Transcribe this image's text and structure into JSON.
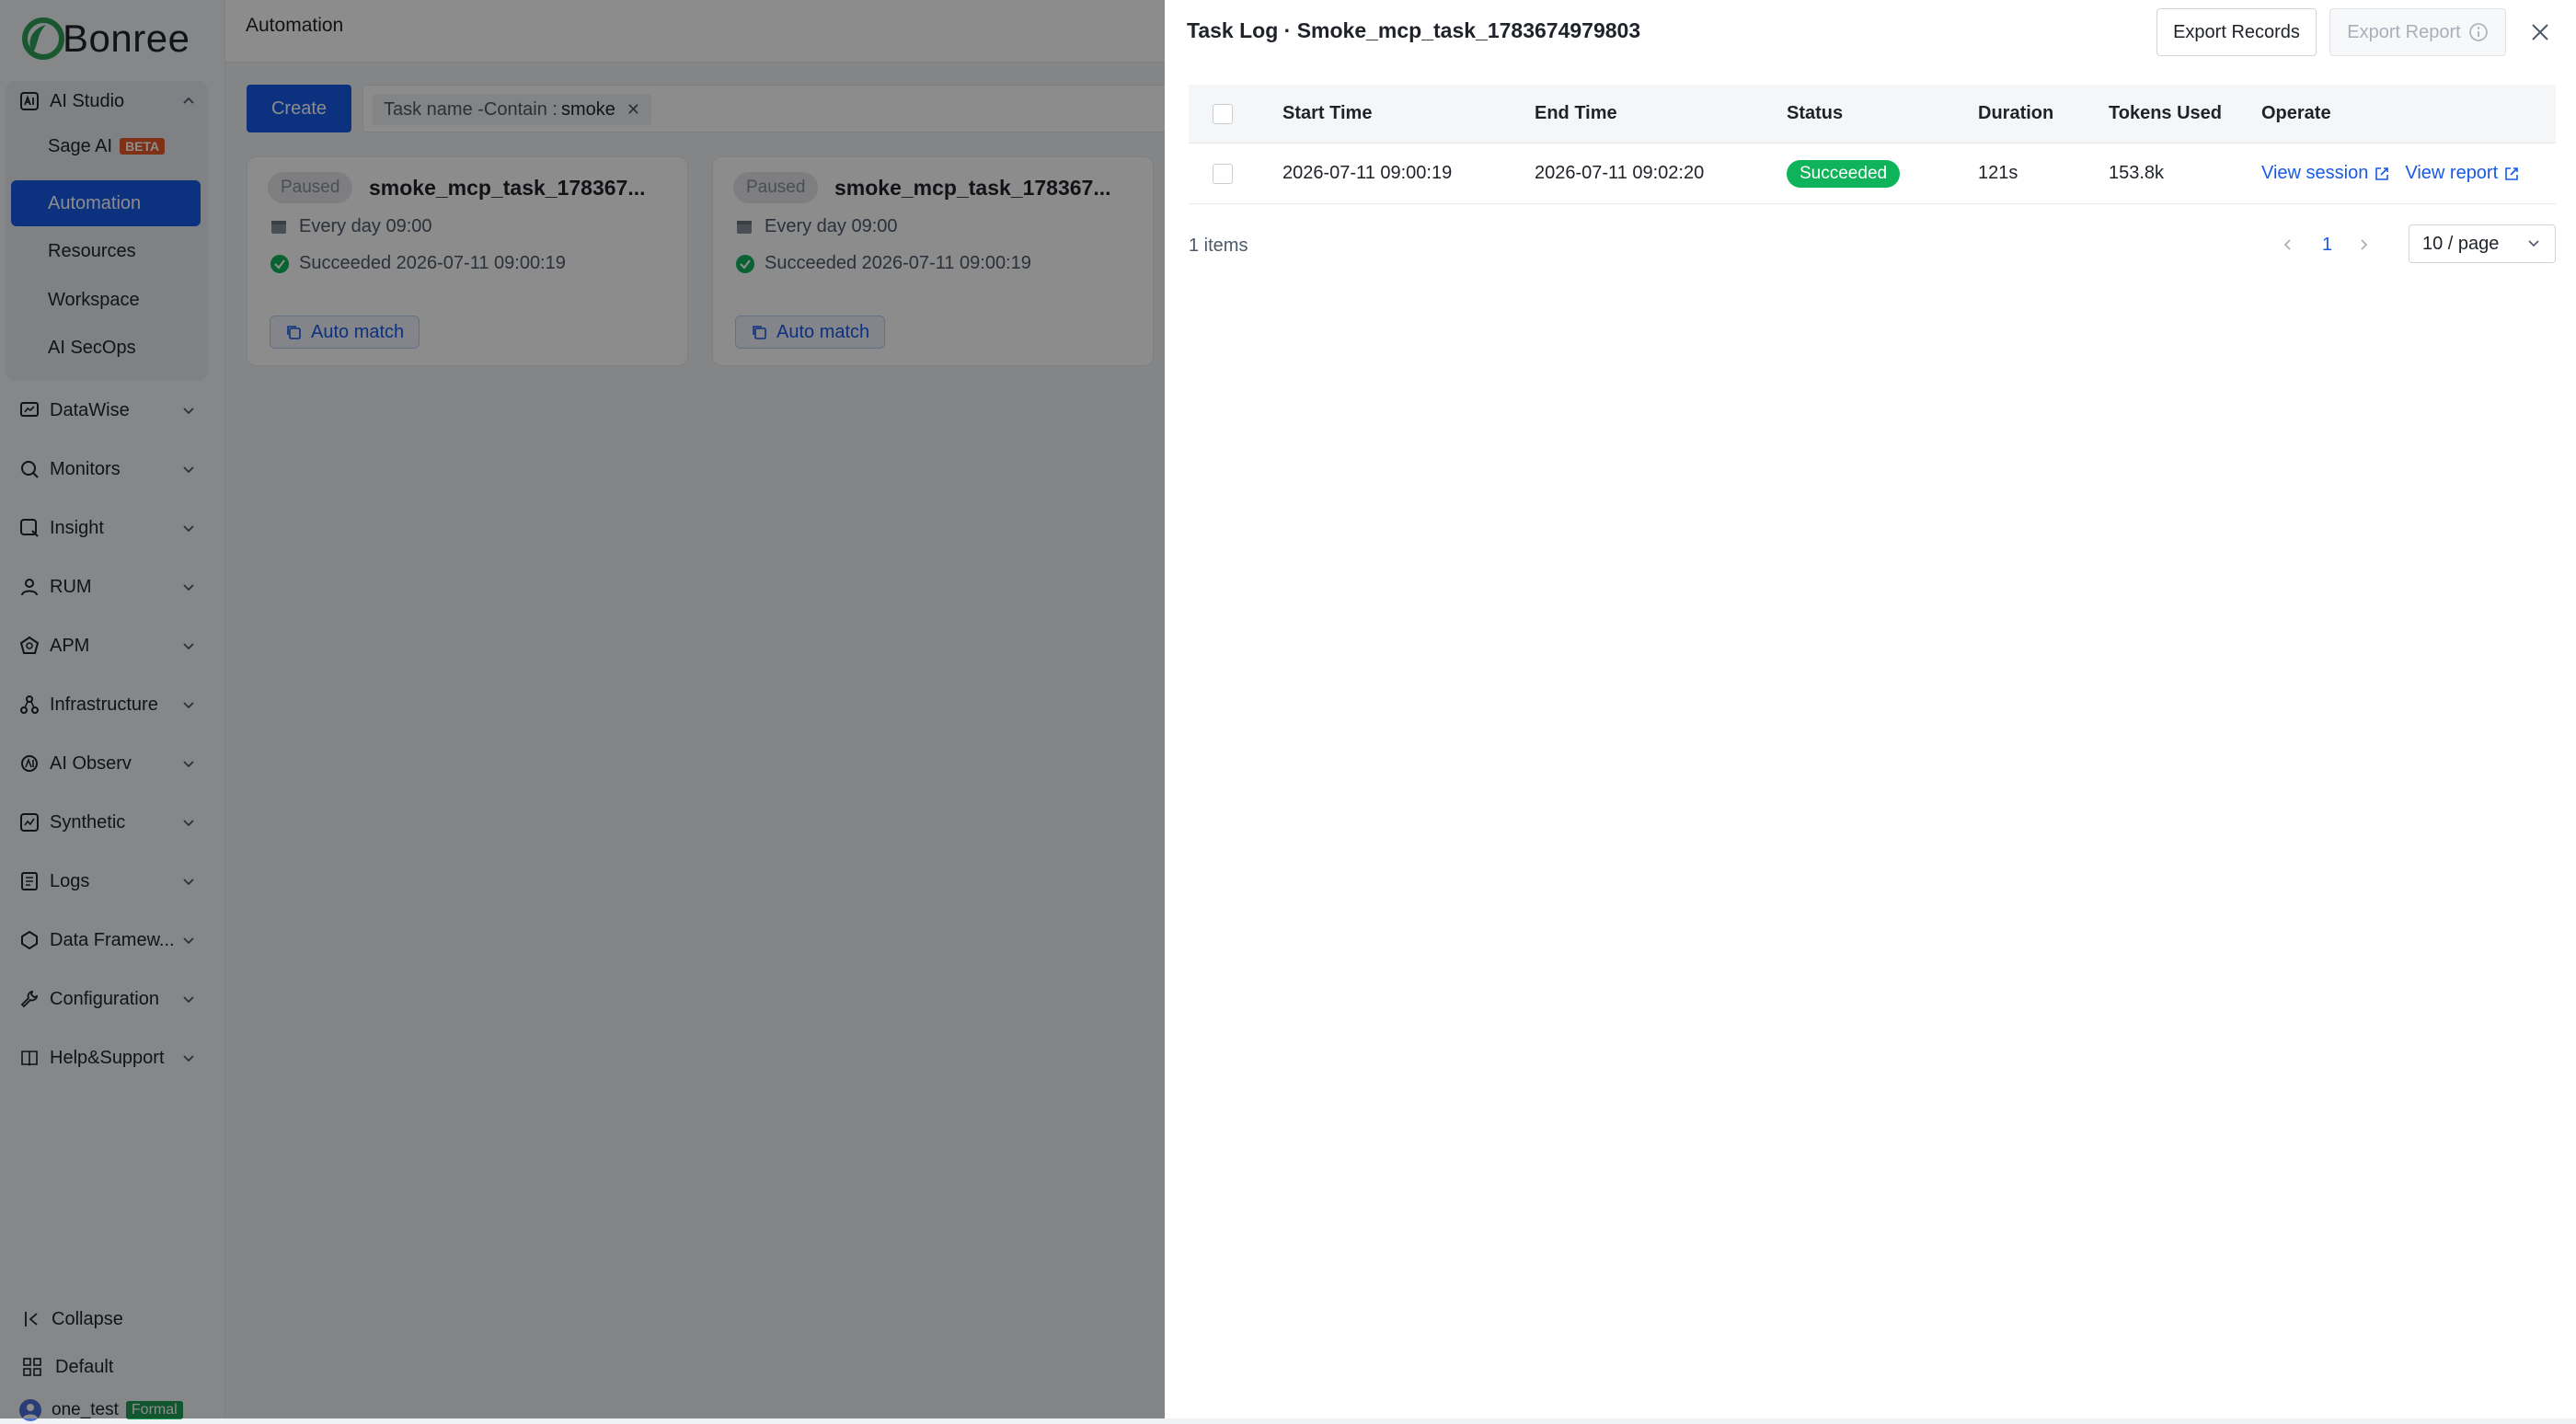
{
  "brand": {
    "name": "Bonree"
  },
  "sidebar": {
    "ai_studio": {
      "label": "AI Studio"
    },
    "sub_items": [
      {
        "label": "Sage AI",
        "badge": "BETA"
      },
      {
        "label": "Automation"
      },
      {
        "label": "Resources"
      },
      {
        "label": "Workspace"
      },
      {
        "label": "AI SecOps"
      }
    ],
    "groups": [
      {
        "label": "DataWise",
        "icon": "datawise-icon"
      },
      {
        "label": "Monitors",
        "icon": "monitors-icon"
      },
      {
        "label": "Insight",
        "icon": "insight-icon"
      },
      {
        "label": "RUM",
        "icon": "rum-icon"
      },
      {
        "label": "APM",
        "icon": "apm-icon"
      },
      {
        "label": "Infrastructure",
        "icon": "infrastructure-icon"
      },
      {
        "label": "AI Observ",
        "icon": "ai-observ-icon"
      },
      {
        "label": "Synthetic",
        "icon": "synthetic-icon"
      },
      {
        "label": "Logs",
        "icon": "logs-icon"
      },
      {
        "label": "Data Framew...",
        "icon": "data-framework-icon"
      },
      {
        "label": "Configuration",
        "icon": "configuration-icon"
      },
      {
        "label": "Help&Support",
        "icon": "help-icon"
      }
    ],
    "collapse_label": "Collapse",
    "default_label": "Default",
    "user": {
      "name": "one_test",
      "badge": "Formal"
    }
  },
  "main": {
    "title": "Automation",
    "create_label": "Create",
    "filter": {
      "field": "Task name -Contain :",
      "value": "smoke"
    },
    "cards": [
      {
        "status": "Paused",
        "name": "smoke_mcp_task_178367...",
        "schedule": "Every day 09:00",
        "last_run": "Succeeded 2026-07-11 09:00:19",
        "action": "Auto match"
      },
      {
        "status": "Paused",
        "name": "smoke_mcp_task_178367...",
        "schedule": "Every day 09:00",
        "last_run": "Succeeded 2026-07-11 09:00:19",
        "action": "Auto match"
      }
    ]
  },
  "drawer": {
    "title": "Task Log · Smoke_mcp_task_1783674979803",
    "export_records_label": "Export Records",
    "export_report_label": "Export Report",
    "columns": [
      "Start Time",
      "End Time",
      "Status",
      "Duration",
      "Tokens Used",
      "Operate"
    ],
    "rows": [
      {
        "start_time": "2026-07-11 09:00:19",
        "end_time": "2026-07-11 09:02:20",
        "status": "Succeeded",
        "duration": "121s",
        "tokens_used": "153.8k",
        "view_session": "View session",
        "view_report": "View report"
      }
    ],
    "total_label": "1 items",
    "current_page": "1",
    "page_size_label": "10 / page"
  },
  "colors": {
    "primary": "#1759e8",
    "success": "#0fb35a",
    "beta_badge": "#e8592a",
    "formal_badge": "#1f9d55"
  }
}
